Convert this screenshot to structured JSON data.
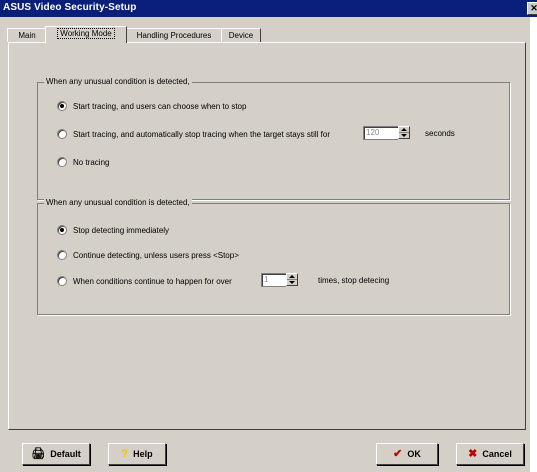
{
  "window": {
    "title": "ASUS Video Security-Setup",
    "close_glyph": "✕"
  },
  "tabs": [
    {
      "label": "Main"
    },
    {
      "label": "Working Mode"
    },
    {
      "label": "Handling Procedures"
    },
    {
      "label": "Device"
    }
  ],
  "group1": {
    "legend": "When any unusual condition is detected,",
    "options": [
      {
        "label": "Start tracing, and users can choose when to stop",
        "selected": true
      },
      {
        "label": "Start tracing, and automatically stop tracing when the target stays still for",
        "selected": false,
        "spin_value": "120",
        "suffix": "seconds"
      },
      {
        "label": "No tracing",
        "selected": false
      }
    ]
  },
  "group2": {
    "legend": "When any unusual condition is detected,",
    "options": [
      {
        "label": "Stop detecting immediately",
        "selected": true
      },
      {
        "label": "Continue detecting, unless users press <Stop>",
        "selected": false
      },
      {
        "label": "When conditions continue to happen for over",
        "selected": false,
        "spin_value": "1",
        "suffix": "times, stop detecing"
      }
    ]
  },
  "buttons": {
    "default": {
      "label": "Default",
      "icon": "default-icon"
    },
    "help": {
      "label": "Help",
      "icon": "help-icon"
    },
    "ok": {
      "label": "OK",
      "icon": "checkmark-icon"
    },
    "cancel": {
      "label": "Cancel",
      "icon": "x-icon"
    }
  },
  "colors": {
    "titlebar": "#0a1f7a",
    "ok_icon": "#c00000",
    "cancel_icon": "#c00000",
    "help_icon": "#f2c200"
  }
}
